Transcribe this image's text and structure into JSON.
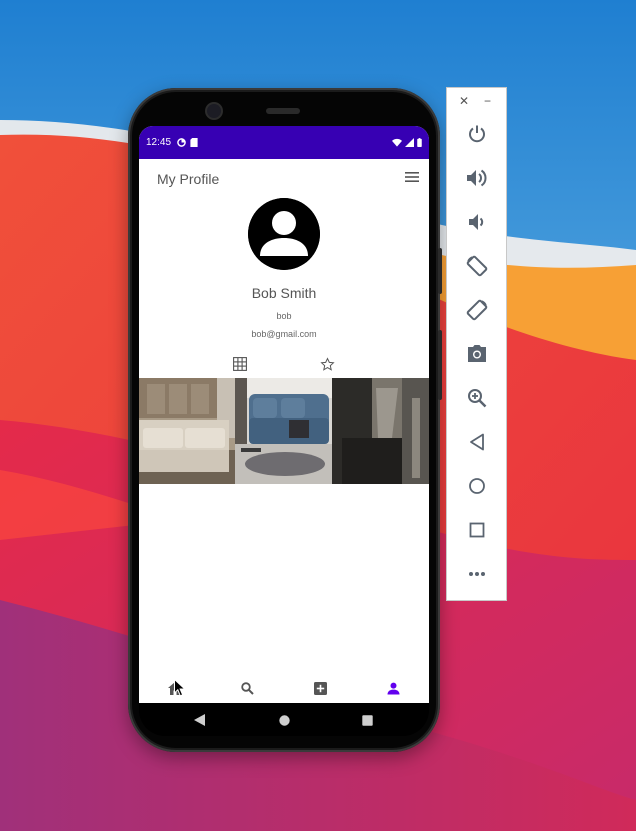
{
  "status_bar": {
    "time": "12:45"
  },
  "header": {
    "title": "My Profile"
  },
  "profile": {
    "name": "Bob Smith",
    "username": "bob",
    "email": "bob@gmail.com"
  },
  "colors": {
    "status_bar": "#3700b3",
    "active_nav": "#6200ee",
    "inactive_nav": "#555555"
  },
  "icons": {
    "menu": "hamburger-menu-icon",
    "grid_tab": "grid-icon",
    "favorites_tab": "star-icon",
    "nav_home": "home-icon",
    "nav_search": "search-icon",
    "nav_add": "add-box-icon",
    "nav_profile": "person-icon"
  }
}
